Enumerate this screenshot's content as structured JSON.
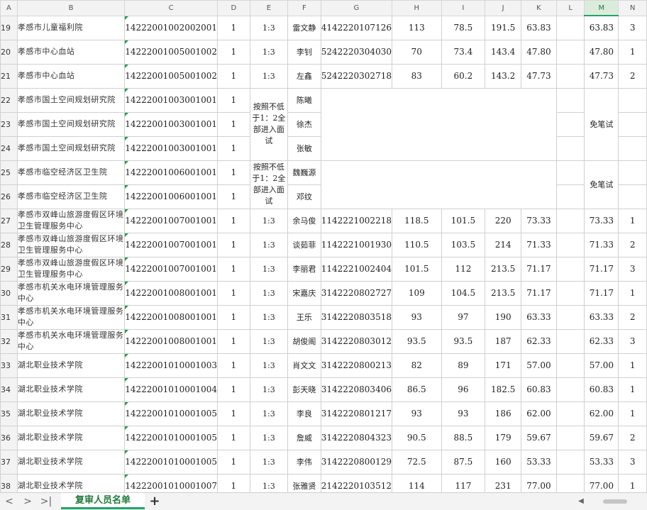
{
  "columns": [
    "A",
    "B",
    "C",
    "D",
    "E",
    "F",
    "G",
    "H",
    "I",
    "J",
    "K",
    "L",
    "M",
    "N"
  ],
  "selected_column": "M",
  "rows": [
    {
      "num": "19",
      "unit": "孝感市儿童福利院",
      "code": "14222001002002001",
      "d": "1",
      "ratio": "1:3",
      "name": "雷文静",
      "ticket": "4142220107126",
      "h": "113",
      "i": "78.5",
      "j": "191.5",
      "k": "63.83",
      "m": "63.83",
      "n": "3"
    },
    {
      "num": "20",
      "unit": "孝感市中心血站",
      "code": "14222001005001002",
      "d": "1",
      "ratio": "1:3",
      "name": "李钊",
      "ticket": "5242220304030",
      "h": "70",
      "i": "73.4",
      "j": "143.4",
      "k": "47.80",
      "m": "47.80",
      "n": "1"
    },
    {
      "num": "21",
      "unit": "孝感市中心血站",
      "code": "14222001005001002",
      "d": "1",
      "ratio": "1:3",
      "name": "左鑫",
      "ticket": "5242220302718",
      "h": "83",
      "i": "60.2",
      "j": "143.2",
      "k": "47.73",
      "m": "47.73",
      "n": "2"
    },
    {
      "num": "22",
      "unit": "孝感市国土空间规划研究院",
      "code": "14222001003001001",
      "d": "1",
      "ratio": "",
      "name": "陈曦",
      "ticket": "",
      "h": "",
      "i": "",
      "j": "",
      "k": "",
      "m": "",
      "n": ""
    },
    {
      "num": "23",
      "unit": "孝感市国土空间规划研究院",
      "code": "14222001003001001",
      "d": "1",
      "ratio": "",
      "name": "徐杰",
      "ticket": "",
      "h": "",
      "i": "",
      "j": "",
      "k": "",
      "m": "",
      "n": ""
    },
    {
      "num": "24",
      "unit": "孝感市国土空间规划研究院",
      "code": "14222001003001001",
      "d": "1",
      "ratio": "",
      "name": "张敏",
      "ticket": "",
      "h": "",
      "i": "",
      "j": "",
      "k": "",
      "m": "",
      "n": ""
    },
    {
      "num": "25",
      "unit": "孝感市临空经济区卫生院",
      "code": "14222001006001001",
      "d": "1",
      "ratio": "",
      "name": "魏巍源",
      "ticket": "",
      "h": "",
      "i": "",
      "j": "",
      "k": "",
      "m": "",
      "n": ""
    },
    {
      "num": "26",
      "unit": "孝感市临空经济区卫生院",
      "code": "14222001006001001",
      "d": "1",
      "ratio": "",
      "name": "邓纹",
      "ticket": "",
      "h": "",
      "i": "",
      "j": "",
      "k": "",
      "m": "",
      "n": ""
    },
    {
      "num": "27",
      "unit": "孝感市双峰山旅游度假区环境卫生管理服务中心",
      "code": "14222001007001001",
      "d": "1",
      "ratio": "1:3",
      "name": "余马俊",
      "ticket": "1142221002218",
      "h": "118.5",
      "i": "101.5",
      "j": "220",
      "k": "73.33",
      "m": "73.33",
      "n": "1"
    },
    {
      "num": "28",
      "unit": "孝感市双峰山旅游度假区环境卫生管理服务中心",
      "code": "14222001007001001",
      "d": "1",
      "ratio": "1:3",
      "name": "谈茹菲",
      "ticket": "1142221001930",
      "h": "110.5",
      "i": "103.5",
      "j": "214",
      "k": "71.33",
      "m": "71.33",
      "n": "2"
    },
    {
      "num": "29",
      "unit": "孝感市双峰山旅游度假区环境卫生管理服务中心",
      "code": "14222001007001001",
      "d": "1",
      "ratio": "1:3",
      "name": "李丽君",
      "ticket": "1142221002404",
      "h": "101.5",
      "i": "112",
      "j": "213.5",
      "k": "71.17",
      "m": "71.17",
      "n": "3"
    },
    {
      "num": "30",
      "unit": "孝感市机关水电环境管理服务中心",
      "code": "14222001008001001",
      "d": "1",
      "ratio": "1:3",
      "name": "宋嘉庆",
      "ticket": "3142220802727",
      "h": "109",
      "i": "104.5",
      "j": "213.5",
      "k": "71.17",
      "m": "71.17",
      "n": "1"
    },
    {
      "num": "31",
      "unit": "孝感市机关水电环境管理服务中心",
      "code": "14222001008001001",
      "d": "1",
      "ratio": "1:3",
      "name": "王乐",
      "ticket": "3142220803518",
      "h": "93",
      "i": "97",
      "j": "190",
      "k": "63.33",
      "m": "63.33",
      "n": "2"
    },
    {
      "num": "32",
      "unit": "孝感市机关水电环境管理服务中心",
      "code": "14222001008001001",
      "d": "1",
      "ratio": "1:3",
      "name": "胡俊阁",
      "ticket": "3142220803012",
      "h": "93.5",
      "i": "93.5",
      "j": "187",
      "k": "62.33",
      "m": "62.33",
      "n": "3"
    },
    {
      "num": "33",
      "unit": "湖北职业技术学院",
      "code": "14222001010001003",
      "d": "1",
      "ratio": "1:3",
      "name": "肖文文",
      "ticket": "3142220800213",
      "h": "82",
      "i": "89",
      "j": "171",
      "k": "57.00",
      "m": "57.00",
      "n": "1"
    },
    {
      "num": "34",
      "unit": "湖北职业技术学院",
      "code": "14222001010001004",
      "d": "1",
      "ratio": "1:3",
      "name": "彭天晓",
      "ticket": "3142220803406",
      "h": "86.5",
      "i": "96",
      "j": "182.5",
      "k": "60.83",
      "m": "60.83",
      "n": "1"
    },
    {
      "num": "35",
      "unit": "湖北职业技术学院",
      "code": "14222001010001005",
      "d": "1",
      "ratio": "1:3",
      "name": "李良",
      "ticket": "3142220801217",
      "h": "93",
      "i": "93",
      "j": "186",
      "k": "62.00",
      "m": "62.00",
      "n": "1"
    },
    {
      "num": "36",
      "unit": "湖北职业技术学院",
      "code": "14222001010001005",
      "d": "1",
      "ratio": "1:3",
      "name": "詹威",
      "ticket": "3142220804323",
      "h": "90.5",
      "i": "88.5",
      "j": "179",
      "k": "59.67",
      "m": "59.67",
      "n": "2"
    },
    {
      "num": "37",
      "unit": "湖北职业技术学院",
      "code": "14222001010001005",
      "d": "1",
      "ratio": "1:3",
      "name": "李伟",
      "ticket": "3142220800129",
      "h": "72.5",
      "i": "87.5",
      "j": "160",
      "k": "53.33",
      "m": "53.33",
      "n": "3"
    },
    {
      "num": "38",
      "unit": "湖北职业技术学院",
      "code": "14222001010001007",
      "d": "1",
      "ratio": "1:3",
      "name": "张雅贤",
      "ticket": "2142220103512",
      "h": "114",
      "i": "117",
      "j": "231",
      "k": "77.00",
      "m": "77.00",
      "n": "1"
    }
  ],
  "merged": {
    "note_22_24": "按照不低于1：2全部进入面试",
    "note_25_26": "按照不低于1：2全部进入面试",
    "exempt_22_24": "免笔试",
    "exempt_25_26": "免笔试"
  },
  "bottom_bar": {
    "nav_prev": "<",
    "nav_next": ">",
    "nav_last": ">|",
    "sheet_tab": "复审人员名单",
    "add_sheet": "+",
    "scroll_left": "◀"
  }
}
